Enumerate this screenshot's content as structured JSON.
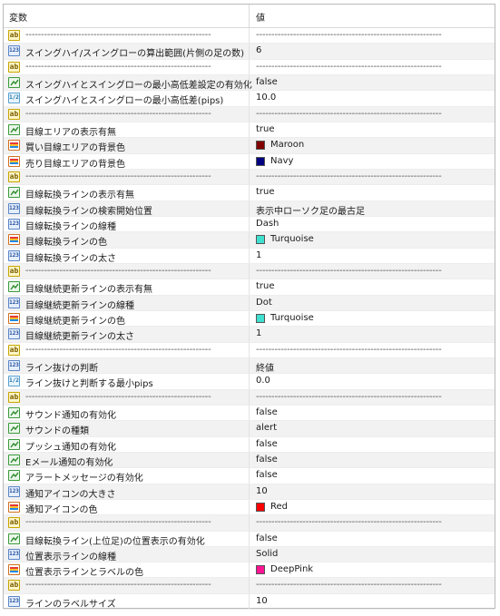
{
  "header": {
    "col_variable": "変数",
    "col_value": "値"
  },
  "rows": [
    {
      "icon": "ab",
      "name": "------------------------------------------------------------",
      "value": "------------------------------------------------------------",
      "sep": true
    },
    {
      "icon": "n123",
      "name": "スイングハイ/スイングローの算出範囲(片側の足の数)",
      "value": "6"
    },
    {
      "icon": "ab",
      "name": "------------------------------------------------------------",
      "value": "------------------------------------------------------------",
      "sep": true
    },
    {
      "icon": "bool",
      "name": "スイングハイとスイングローの最小高低差設定の有効化",
      "value": "false"
    },
    {
      "icon": "n12",
      "name": "スイングハイとスイングローの最小高低差(pips)",
      "value": "10.0"
    },
    {
      "icon": "ab",
      "name": "------------------------------------------------------------",
      "value": "------------------------------------------------------------",
      "sep": true
    },
    {
      "icon": "bool",
      "name": "目線エリアの表示有無",
      "value": "true"
    },
    {
      "icon": "color",
      "name": "買い目線エリアの背景色",
      "value": "Maroon",
      "swatch": "#800000"
    },
    {
      "icon": "color",
      "name": "売り目線エリアの背景色",
      "value": "Navy",
      "swatch": "#000080"
    },
    {
      "icon": "ab",
      "name": "------------------------------------------------------------",
      "value": "------------------------------------------------------------",
      "sep": true
    },
    {
      "icon": "bool",
      "name": "目線転換ラインの表示有無",
      "value": "true"
    },
    {
      "icon": "n123",
      "name": "目線転換ラインの検索開始位置",
      "value": "表示中ローソク足の最古足"
    },
    {
      "icon": "n123",
      "name": "目線転換ラインの線種",
      "value": "Dash"
    },
    {
      "icon": "color",
      "name": "目線転換ラインの色",
      "value": "Turquoise",
      "swatch": "#40e0d0"
    },
    {
      "icon": "n123",
      "name": "目線転換ラインの太さ",
      "value": "1"
    },
    {
      "icon": "ab",
      "name": "------------------------------------------------------------",
      "value": "------------------------------------------------------------",
      "sep": true
    },
    {
      "icon": "bool",
      "name": "目線継続更新ラインの表示有無",
      "value": "true"
    },
    {
      "icon": "n123",
      "name": "目線継続更新ラインの線種",
      "value": "Dot"
    },
    {
      "icon": "color",
      "name": "目線継続更新ラインの色",
      "value": "Turquoise",
      "swatch": "#40e0d0"
    },
    {
      "icon": "n123",
      "name": "目線継続更新ラインの太さ",
      "value": "1"
    },
    {
      "icon": "ab",
      "name": "------------------------------------------------------------",
      "value": "------------------------------------------------------------",
      "sep": true
    },
    {
      "icon": "n123",
      "name": "ライン抜けの判断",
      "value": "終値"
    },
    {
      "icon": "n12",
      "name": "ライン抜けと判断する最小pips",
      "value": "0.0"
    },
    {
      "icon": "ab",
      "name": "------------------------------------------------------------",
      "value": "------------------------------------------------------------",
      "sep": true
    },
    {
      "icon": "bool",
      "name": "サウンド通知の有効化",
      "value": "false"
    },
    {
      "icon": "bool",
      "name": "サウンドの種類",
      "value": "alert"
    },
    {
      "icon": "bool",
      "name": "プッシュ通知の有効化",
      "value": "false"
    },
    {
      "icon": "bool",
      "name": "Eメール通知の有効化",
      "value": "false"
    },
    {
      "icon": "bool",
      "name": "アラートメッセージの有効化",
      "value": "false"
    },
    {
      "icon": "n123",
      "name": "通知アイコンの大きさ",
      "value": "10"
    },
    {
      "icon": "color",
      "name": "通知アイコンの色",
      "value": "Red",
      "swatch": "#ff0000"
    },
    {
      "icon": "ab",
      "name": "------------------------------------------------------------",
      "value": "------------------------------------------------------------",
      "sep": true
    },
    {
      "icon": "bool",
      "name": "目線転換ライン(上位足)の位置表示の有効化",
      "value": "false"
    },
    {
      "icon": "n123",
      "name": "位置表示ラインの線種",
      "value": "Solid"
    },
    {
      "icon": "color",
      "name": "位置表示ラインとラベルの色",
      "value": "DeepPink",
      "swatch": "#ff1493"
    },
    {
      "icon": "ab",
      "name": "------------------------------------------------------------",
      "value": "------------------------------------------------------------",
      "sep": true
    },
    {
      "icon": "n123",
      "name": "ラインのラベルサイズ",
      "value": "10"
    }
  ],
  "icons": {
    "ab": "string-type-icon",
    "n123": "integer-type-icon",
    "n12": "double-type-icon",
    "bool": "bool-type-icon",
    "color": "color-type-icon"
  },
  "icon_text": {
    "ab": "ab",
    "n123": "123",
    "n12": "1/2"
  }
}
